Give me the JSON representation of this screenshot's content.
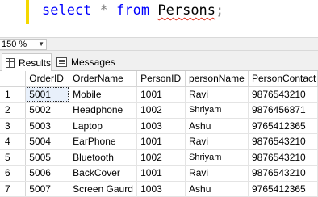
{
  "editor": {
    "keyword_select": "select",
    "star": "*",
    "keyword_from": "from",
    "table_name": "Persons",
    "semicolon": ";"
  },
  "zoom": {
    "value": "150 %"
  },
  "tabs": [
    {
      "label": "Results",
      "icon": "results-grid-icon",
      "active": true
    },
    {
      "label": "Messages",
      "icon": "messages-icon",
      "active": false
    }
  ],
  "grid": {
    "columns": [
      "",
      "OrderID",
      "OrderName",
      "PersonID",
      "personName",
      "PersonContact"
    ],
    "rows": [
      [
        "1",
        "5001",
        "Mobile",
        "1001",
        "Ravi",
        "9876543210"
      ],
      [
        "2",
        "5002",
        "Headphone",
        "1002",
        "Shriyam",
        "9876456871"
      ],
      [
        "3",
        "5003",
        "Laptop",
        "1003",
        "Ashu",
        "9765412365"
      ],
      [
        "4",
        "5004",
        "EarPhone",
        "1001",
        "Ravi",
        "9876543210"
      ],
      [
        "5",
        "5005",
        "Bluetooth",
        "1002",
        "Shriyam",
        "9876543210"
      ],
      [
        "6",
        "5006",
        "BackCover",
        "1001",
        "Ravi",
        "9876543210"
      ],
      [
        "7",
        "5007",
        "Screen Gaurd",
        "1003",
        "Ashu",
        "9765412365"
      ]
    ]
  }
}
